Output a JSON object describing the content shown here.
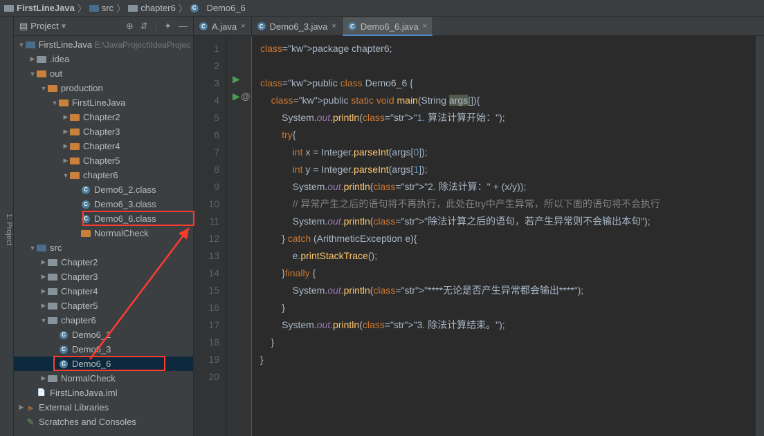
{
  "breadcrumbs": [
    "FirstLineJava",
    "src",
    "chapter6",
    "Demo6_6"
  ],
  "side_tab": "1: Project",
  "panel": {
    "title": "Project",
    "toolbar_icons": [
      "target-icon",
      "expand-icon",
      "divider",
      "gear-icon",
      "hide-icon"
    ]
  },
  "tree": [
    {
      "depth": 0,
      "arrow": "▼",
      "icon": "folder-blue",
      "label": "FirstLineJava",
      "path": "E:\\JavaProject\\IdeaProjec"
    },
    {
      "depth": 1,
      "arrow": "▶",
      "icon": "folder",
      "label": ".idea"
    },
    {
      "depth": 1,
      "arrow": "▼",
      "icon": "folder-orange",
      "label": "out"
    },
    {
      "depth": 2,
      "arrow": "▼",
      "icon": "folder-orange",
      "label": "production"
    },
    {
      "depth": 3,
      "arrow": "▼",
      "icon": "folder-orange",
      "label": "FirstLineJava"
    },
    {
      "depth": 4,
      "arrow": "▶",
      "icon": "folder-orange",
      "label": "Chapter2"
    },
    {
      "depth": 4,
      "arrow": "▶",
      "icon": "folder-orange",
      "label": "Chapter3"
    },
    {
      "depth": 4,
      "arrow": "▶",
      "icon": "folder-orange",
      "label": "Chapter4"
    },
    {
      "depth": 4,
      "arrow": "▶",
      "icon": "folder-orange",
      "label": "Chapter5"
    },
    {
      "depth": 4,
      "arrow": "▼",
      "icon": "folder-orange",
      "label": "chapter6"
    },
    {
      "depth": 5,
      "arrow": "",
      "icon": "class",
      "label": "Demo6_2.class"
    },
    {
      "depth": 5,
      "arrow": "",
      "icon": "class",
      "label": "Demo6_3.class"
    },
    {
      "depth": 5,
      "arrow": "",
      "icon": "class",
      "label": "Demo6_6.class",
      "red": true
    },
    {
      "depth": 5,
      "arrow": "",
      "icon": "folder-orange",
      "label": "NormalCheck"
    },
    {
      "depth": 1,
      "arrow": "▼",
      "icon": "folder-blue",
      "label": "src"
    },
    {
      "depth": 2,
      "arrow": "▶",
      "icon": "folder",
      "label": "Chapter2"
    },
    {
      "depth": 2,
      "arrow": "▶",
      "icon": "folder",
      "label": "Chapter3"
    },
    {
      "depth": 2,
      "arrow": "▶",
      "icon": "folder",
      "label": "Chapter4"
    },
    {
      "depth": 2,
      "arrow": "▶",
      "icon": "folder",
      "label": "Chapter5"
    },
    {
      "depth": 2,
      "arrow": "▼",
      "icon": "folder",
      "label": "chapter6"
    },
    {
      "depth": 3,
      "arrow": "",
      "icon": "class",
      "label": "Demo6_2"
    },
    {
      "depth": 3,
      "arrow": "",
      "icon": "class",
      "label": "Demo6_3"
    },
    {
      "depth": 3,
      "arrow": "",
      "icon": "class",
      "label": "Demo6_6",
      "red": true,
      "sel": true
    },
    {
      "depth": 2,
      "arrow": "▶",
      "icon": "folder",
      "label": "NormalCheck"
    },
    {
      "depth": 1,
      "arrow": "",
      "icon": "file",
      "label": "FirstLineJava.iml"
    },
    {
      "depth": 0,
      "arrow": "▶",
      "icon": "lib",
      "label": "External Libraries"
    },
    {
      "depth": 0,
      "arrow": "",
      "icon": "scratch",
      "label": "Scratches and Consoles"
    }
  ],
  "tabs": [
    {
      "label": "A.java",
      "icon": "class",
      "active": false
    },
    {
      "label": "Demo6_3.java",
      "icon": "class",
      "active": false
    },
    {
      "label": "Demo6_6.java",
      "icon": "class",
      "active": true
    }
  ],
  "code": {
    "lines": 20,
    "src": "package chapter6;\n\npublic class Demo6_6 {\n    public static void main(String args[]){\n        System.out.println(\"1. 算法计算开始：\");\n        try{\n            int x = Integer.parseInt(args[0]);\n            int y = Integer.parseInt(args[1]);\n            System.out.println(\"2. 除法计算：\" + (x/y));\n            // 异常产生之后的语句将不再执行，此处在try中产生异常，所以下面的语句将不会执行\n            System.out.println(\"除法计算之后的语句，若产生异常则不会输出本句\");\n        } catch (ArithmeticException e){\n            e.printStackTrace();\n        }finally {\n            System.out.println(\"****无论是否产生异常都会输出****\");\n        }\n        System.out.println(\"3. 除法计算结束。\");\n    }\n}\n"
  }
}
